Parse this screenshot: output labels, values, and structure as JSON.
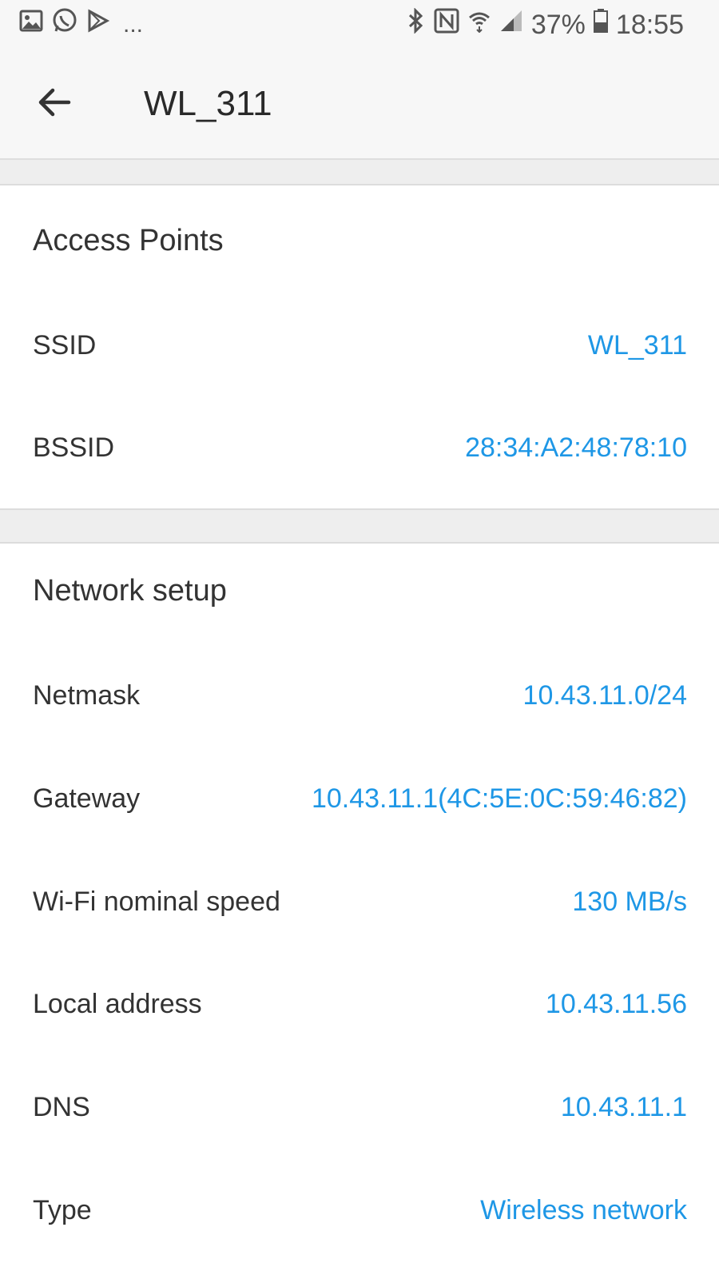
{
  "status_bar": {
    "battery": "37%",
    "time": "18:55",
    "dots": "...",
    "icons": [
      "gallery-icon",
      "whatsapp-icon",
      "play-store-icon",
      "bluetooth-icon",
      "nfc-icon",
      "wifi-icon",
      "signal-icon",
      "battery-icon"
    ]
  },
  "header": {
    "title": "WL_311"
  },
  "access_points": {
    "title": "Access Points",
    "rows": [
      {
        "label": "SSID",
        "value": "WL_311"
      },
      {
        "label": "BSSID",
        "value": "28:34:A2:48:78:10"
      }
    ]
  },
  "network_setup": {
    "title": "Network setup",
    "rows": [
      {
        "label": "Netmask",
        "value": "10.43.11.0/24"
      },
      {
        "label": "Gateway",
        "value": "10.43.11.1(4C:5E:0C:59:46:82)"
      },
      {
        "label": "Wi-Fi nominal speed",
        "value": "130 MB/s"
      },
      {
        "label": "Local address",
        "value": "10.43.11.56"
      },
      {
        "label": "DNS",
        "value": "10.43.11.1"
      },
      {
        "label": "Type",
        "value": "Wireless network"
      }
    ]
  },
  "colors": {
    "accent": "#1e97e6",
    "text": "#333333",
    "background": "#ffffff",
    "divider": "#eeeeee"
  }
}
